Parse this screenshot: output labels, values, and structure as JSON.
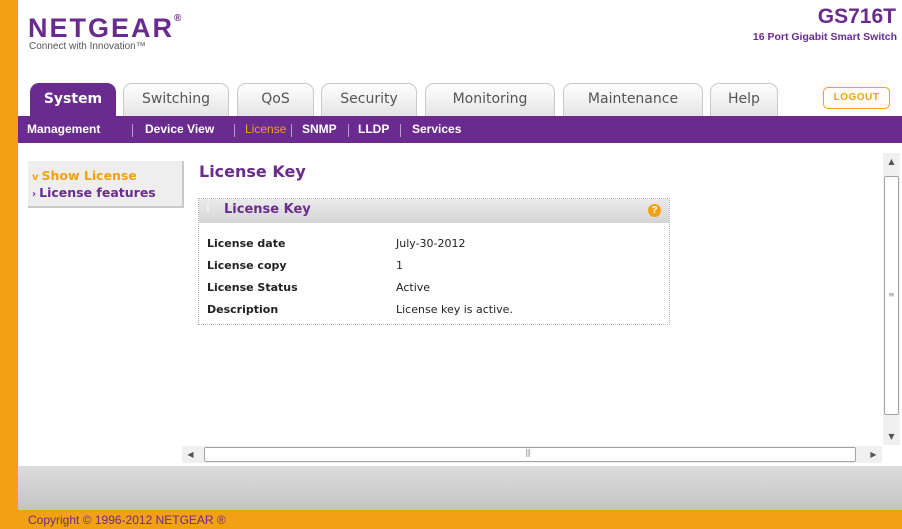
{
  "header": {
    "brand": "NETGEAR",
    "brand_mark": "®",
    "tagline": "Connect with Innovation™",
    "model": "GS716T",
    "model_description": "16 Port Gigabit Smart Switch"
  },
  "tabs": [
    {
      "label": "System",
      "active": true
    },
    {
      "label": "Switching",
      "active": false
    },
    {
      "label": "QoS",
      "active": false
    },
    {
      "label": "Security",
      "active": false
    },
    {
      "label": "Monitoring",
      "active": false
    },
    {
      "label": "Maintenance",
      "active": false
    },
    {
      "label": "Help",
      "active": false
    }
  ],
  "logout_label": "LOGOUT",
  "subnav": [
    {
      "label": "Management",
      "active": false
    },
    {
      "label": "Device View",
      "active": false
    },
    {
      "label": "License",
      "active": true
    },
    {
      "label": "SNMP",
      "active": false
    },
    {
      "label": "LLDP",
      "active": false
    },
    {
      "label": "Services",
      "active": false
    }
  ],
  "sidebar": {
    "items": [
      {
        "label": "Show License",
        "marker": "v",
        "active": true
      },
      {
        "label": "License features",
        "marker": "›",
        "active": false
      }
    ]
  },
  "page_title": "License Key",
  "panel": {
    "title": "License Key",
    "help_symbol": "?",
    "rows": [
      {
        "label": "License date",
        "value": "July-30-2012"
      },
      {
        "label": "License copy",
        "value": "1"
      },
      {
        "label": "License Status",
        "value": "Active"
      },
      {
        "label": "Description",
        "value": "License key is active."
      }
    ]
  },
  "footer": {
    "copyright": "Copyright © 1996-2012 NETGEAR ®"
  },
  "colors": {
    "brand_purple": "#6a2b8f",
    "accent_orange": "#f3a114",
    "panel_header": "#dcdcdc"
  },
  "icons": {
    "help": "help-icon",
    "scroll_up": "scroll-up-arrow-icon",
    "scroll_down": "scroll-down-arrow-icon",
    "scroll_left": "scroll-left-arrow-icon",
    "scroll_right": "scroll-right-arrow-icon"
  }
}
